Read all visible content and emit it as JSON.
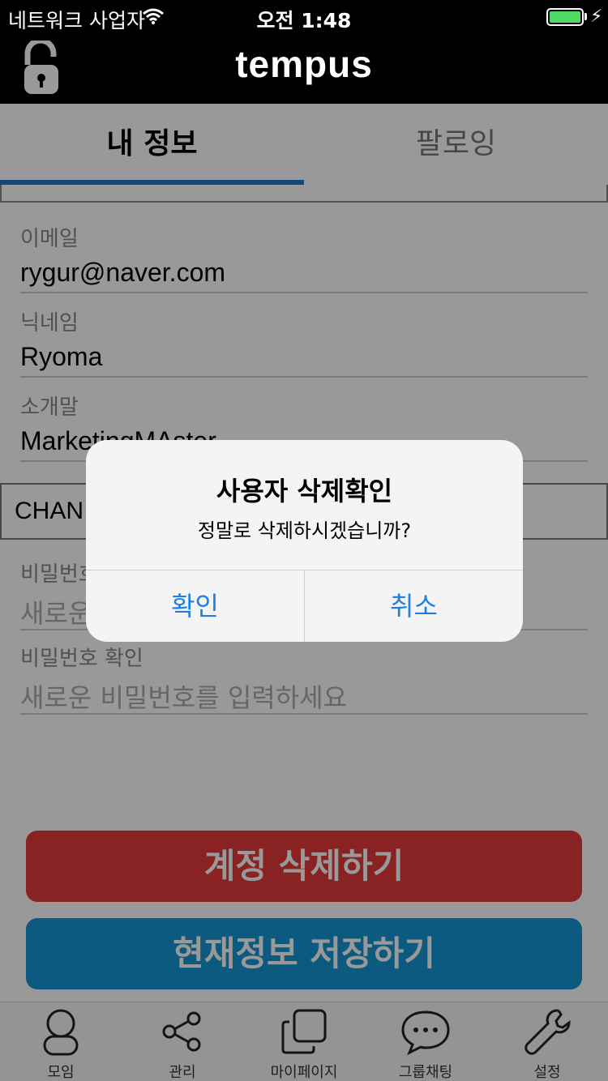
{
  "status_bar": {
    "carrier": "네트워크 사업자",
    "time": "오전 1:48",
    "battery_level": 1.0
  },
  "nav": {
    "title": "tempus",
    "lock_icon": "unlocked-padlock-icon"
  },
  "tabs": [
    {
      "label": "내 정보",
      "selected": true
    },
    {
      "label": "팔로잉",
      "selected": false
    }
  ],
  "form": {
    "email_label": "이메일",
    "email_value": "rygur@naver.com",
    "nickname_label": "닉네임",
    "nickname_value": "Ryoma",
    "intro_label": "소개말",
    "intro_value": "MarketingMAster",
    "change_label": "CHAN",
    "password_label": "비밀번호",
    "password_placeholder": "새로운",
    "password_confirm_label": "비밀번호 확인",
    "password_confirm_placeholder": "새로운 비밀번호를 입력하세요"
  },
  "buttons": {
    "delete_account": "계정 삭제하기",
    "save_info": "현재정보 저장하기"
  },
  "tab_bar": [
    {
      "label": "모임",
      "icon": "person-icon"
    },
    {
      "label": "관리",
      "icon": "share-icon"
    },
    {
      "label": "마이페이지",
      "icon": "squares-icon"
    },
    {
      "label": "그룹채팅",
      "icon": "chat-bubble-icon"
    },
    {
      "label": "설정",
      "icon": "wrench-icon"
    }
  ],
  "alert": {
    "title": "사용자 삭제확인",
    "message": "정말로 삭제하시겠습니까?",
    "confirm": "확인",
    "cancel": "취소"
  },
  "colors": {
    "tab_indicator": "#1d78c4",
    "delete_button": "#e53a3a",
    "save_button": "#1697d8",
    "alert_button_text": "#1b7fe6"
  }
}
